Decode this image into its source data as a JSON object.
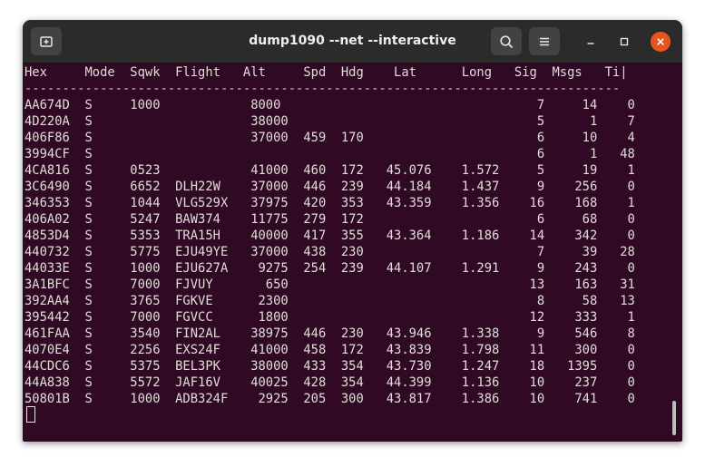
{
  "window": {
    "title": "dump1090 --net --interactive"
  },
  "titlebar": {
    "new_tab_icon": "new-tab-icon",
    "search_icon": "search-icon",
    "menu_icon": "hamburger-menu-icon",
    "minimize_icon": "minimize-icon",
    "maximize_icon": "maximize-icon",
    "close_icon": "close-icon",
    "close_color": "#e95420"
  },
  "terminal": {
    "header": "Hex     Mode  Sqwk  Flight   Alt     Spd  Hdg    Lat      Long   Sig  Msgs   Ti|",
    "separator": "-------------------------------------------------------------------------------",
    "rows": [
      "AA674D  S     1000            8000                                  7     14    0",
      "4D220A  S                     38000                                 5      1    7",
      "406F86  S                     37000  459  170                       6     10    4",
      "3994CF  S                                                           6      1   48",
      "4CA816  S     0523            41000  460  172   45.076    1.572     5     19    1",
      "3C6490  S     6652  DLH22W    37000  446  239   44.184    1.437     9    256    0",
      "346353  S     1044  VLG529X   37975  420  353   43.359    1.356    16    168    1",
      "406A02  S     5247  BAW374    11775  279  172                       6     68    0",
      "4853D4  S     5353  TRA15H    40000  417  355   43.364    1.186    14    342    0",
      "440732  S     5775  EJU49YE   37000  438  230                       7     39   28",
      "44033E  S     1000  EJU627A    9275  254  239   44.107    1.291     9    243    0",
      "3A1BFC  S     7000  FJVUY       650                                13    163   31",
      "392AA4  S     3765  FGKVE      2300                                 8     58   13",
      "395442  S     7000  FGVCC      1800                                12    333    1",
      "461FAA  S     3540  FIN2AL    38975  446  230   43.946    1.338     9    546    8",
      "4070E4  S     2256  EXS24F    41000  458  172   43.839    1.798    11    300    0",
      "44CDC6  S     5375  BEL3PK    38000  433  354   43.730    1.247    18   1395    0",
      "44A838  S     5572  JAF16V    40025  428  354   44.399    1.136    10    237    0",
      "50801B  S     1000  ADB324F    2925  205  300   43.817    1.386    10    741    0"
    ]
  }
}
